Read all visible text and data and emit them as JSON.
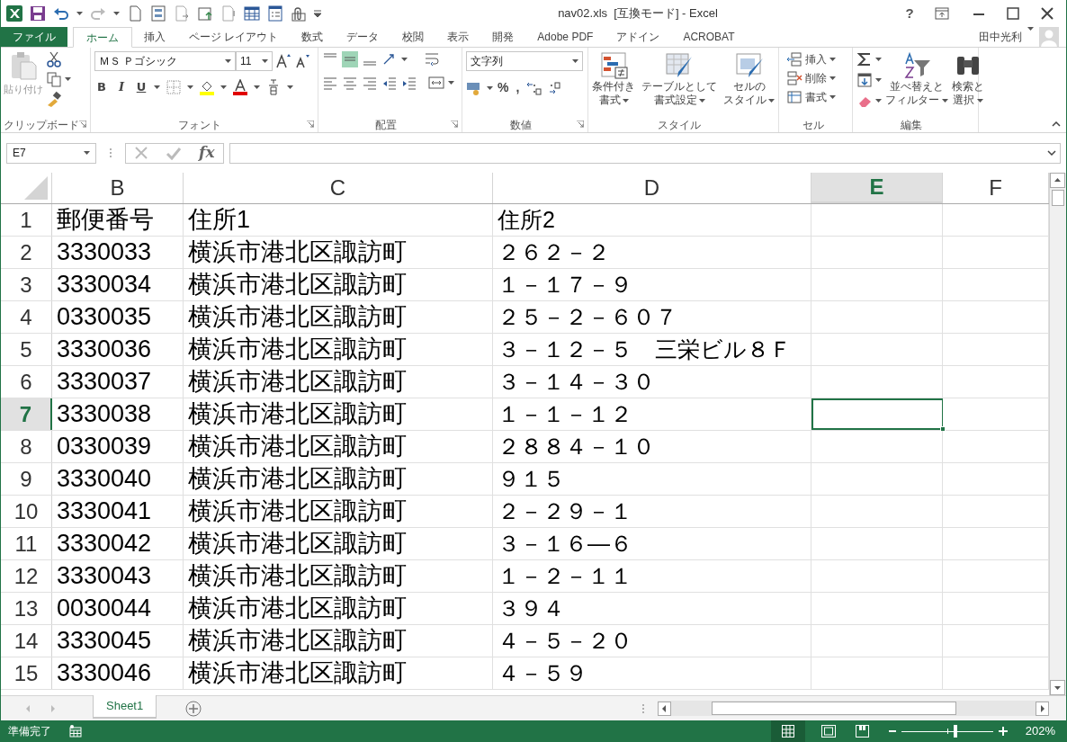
{
  "window": {
    "title": "nav02.xls  [互換モード] - Excel",
    "help": "?",
    "user": "田中光利"
  },
  "tabs": [
    {
      "label": "ファイル",
      "kind": "file",
      "selected": false
    },
    {
      "label": "ホーム",
      "kind": "tab",
      "selected": true
    },
    {
      "label": "挿入",
      "kind": "tab",
      "selected": false
    },
    {
      "label": "ページ レイアウト",
      "kind": "tab",
      "selected": false
    },
    {
      "label": "数式",
      "kind": "tab",
      "selected": false
    },
    {
      "label": "データ",
      "kind": "tab",
      "selected": false
    },
    {
      "label": "校閲",
      "kind": "tab",
      "selected": false
    },
    {
      "label": "表示",
      "kind": "tab",
      "selected": false
    },
    {
      "label": "開発",
      "kind": "tab",
      "selected": false
    },
    {
      "label": "Adobe PDF",
      "kind": "tab",
      "selected": false
    },
    {
      "label": "アドイン",
      "kind": "tab",
      "selected": false
    },
    {
      "label": "ACROBAT",
      "kind": "tab",
      "selected": false
    }
  ],
  "ribbon": {
    "clipboard": {
      "name": "クリップボード",
      "paste": "貼り付け"
    },
    "font": {
      "name": "フォント",
      "font_name": "ＭＳ Ｐゴシック",
      "font_size": "11",
      "bold": "B",
      "italic": "I",
      "underline": "U"
    },
    "alignment": {
      "name": "配置"
    },
    "number": {
      "name": "数値",
      "format": "文字列",
      "percent": "%",
      "comma": ","
    },
    "styles": {
      "name": "スタイル",
      "buttons": [
        [
          "条件付き",
          "書式"
        ],
        [
          "テーブルとして",
          "書式設定"
        ],
        [
          "セルの",
          "スタイル"
        ]
      ]
    },
    "cells": {
      "name": "セル",
      "buttons": [
        "挿入",
        "削除",
        "書式"
      ]
    },
    "editing": {
      "name": "編集",
      "buttons": [
        [
          "並べ替えと",
          "フィルター"
        ],
        [
          "検索と",
          "選択"
        ]
      ]
    }
  },
  "formula_bar": {
    "name_box": "E7",
    "fx": "fx"
  },
  "columns": [
    {
      "label": "B",
      "selected": false
    },
    {
      "label": "C",
      "selected": false
    },
    {
      "label": "D",
      "selected": false
    },
    {
      "label": "E",
      "selected": true
    },
    {
      "label": "F",
      "selected": false
    }
  ],
  "rows": [
    {
      "number": "1",
      "selected": false,
      "cells": [
        "郵便番号",
        "住所1",
        "住所2"
      ]
    },
    {
      "number": "2",
      "selected": false,
      "cells": [
        "3330033",
        "横浜市港北区諏訪町",
        "２６２－２"
      ]
    },
    {
      "number": "3",
      "selected": false,
      "cells": [
        "3330034",
        "横浜市港北区諏訪町",
        "１－１７－９"
      ]
    },
    {
      "number": "4",
      "selected": false,
      "cells": [
        "0330035",
        "横浜市港北区諏訪町",
        "２５－２－６０７"
      ]
    },
    {
      "number": "5",
      "selected": false,
      "cells": [
        "3330036",
        "横浜市港北区諏訪町",
        "３－１２－５　三栄ビル８Ｆ"
      ]
    },
    {
      "number": "6",
      "selected": false,
      "cells": [
        "3330037",
        "横浜市港北区諏訪町",
        "３－１４－３０"
      ]
    },
    {
      "number": "7",
      "selected": true,
      "cells": [
        "3330038",
        "横浜市港北区諏訪町",
        "１－１－１２"
      ]
    },
    {
      "number": "8",
      "selected": false,
      "cells": [
        "0330039",
        "横浜市港北区諏訪町",
        "２８８４－１０"
      ]
    },
    {
      "number": "9",
      "selected": false,
      "cells": [
        "3330040",
        "横浜市港北区諏訪町",
        "９１５"
      ]
    },
    {
      "number": "10",
      "selected": false,
      "cells": [
        "3330041",
        "横浜市港北区諏訪町",
        "２－２９－１"
      ]
    },
    {
      "number": "11",
      "selected": false,
      "cells": [
        "3330042",
        "横浜市港北区諏訪町",
        "３－１６―６"
      ]
    },
    {
      "number": "12",
      "selected": false,
      "cells": [
        "3330043",
        "横浜市港北区諏訪町",
        "１－２－１１"
      ]
    },
    {
      "number": "13",
      "selected": false,
      "cells": [
        "0030044",
        "横浜市港北区諏訪町",
        "３９４"
      ]
    },
    {
      "number": "14",
      "selected": false,
      "cells": [
        "3330045",
        "横浜市港北区諏訪町",
        "４－５－２０"
      ]
    },
    {
      "number": "15",
      "selected": false,
      "cells": [
        "3330046",
        "横浜市港北区諏訪町",
        "４－５９"
      ]
    }
  ],
  "sheets": [
    {
      "label": "Sheet1",
      "selected": true
    }
  ],
  "status_bar": {
    "text": "準備完了",
    "zoom": "202%",
    "zoom_slider": {
      "level": 0.6
    }
  }
}
